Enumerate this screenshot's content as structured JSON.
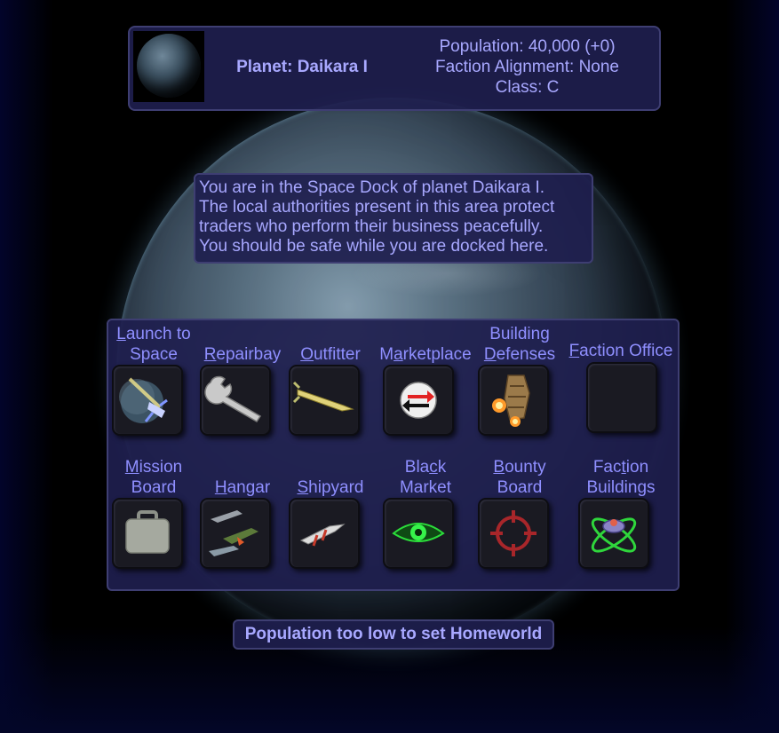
{
  "header": {
    "planet_label": "Planet: Daikara I",
    "population": "Population: 40,000 (+0)",
    "faction_alignment": "Faction Alignment: None",
    "class": "Class: C"
  },
  "message": {
    "lines": [
      "You are in the Space Dock of planet Daikara I.",
      "The local authorities present in this area protect",
      "traders who perform their business peacefully.",
      "You should be safe while you are docked here."
    ]
  },
  "menu": {
    "launch": {
      "hotkey": "L",
      "rest_line1": "aunch to",
      "line2": "Space",
      "icon": "launch-ship-icon"
    },
    "repairbay": {
      "hotkey": "R",
      "rest": "epairbay",
      "icon": "wrench-icon"
    },
    "outfitter": {
      "hotkey": "O",
      "rest": "utfitter",
      "icon": "missile-icon"
    },
    "marketplace": {
      "pre": "M",
      "hotkey": "a",
      "rest": "rketplace",
      "icon": "trade-arrows-icon"
    },
    "building_defenses": {
      "line1": "Building",
      "hotkey": "D",
      "rest_line2": "efenses",
      "icon": "defense-turret-icon"
    },
    "faction_office": {
      "hotkey": "F",
      "rest": "action Office",
      "icon": "empty-icon"
    },
    "mission_board": {
      "hotkey": "M",
      "rest_line1": "ission",
      "line2": "Board",
      "icon": "briefcase-icon"
    },
    "hangar": {
      "hotkey": "H",
      "rest": "angar",
      "icon": "ships-icon"
    },
    "shipyard": {
      "hotkey": "S",
      "rest": "hipyard",
      "icon": "shipyard-ship-icon"
    },
    "black_market": {
      "pre": "Bla",
      "hotkey": "c",
      "rest_line1": "k",
      "line2": "Market",
      "icon": "eye-icon"
    },
    "bounty_board": {
      "hotkey": "B",
      "rest_line1": "ounty",
      "line2": "Board",
      "icon": "crosshair-icon"
    },
    "faction_buildings": {
      "pre": "Fac",
      "hotkey": "t",
      "rest_line1": "ion",
      "line2": "Buildings",
      "icon": "atom-station-icon"
    }
  },
  "footer": {
    "homeworld_status": "Population too low to set Homeworld"
  },
  "colors": {
    "panel_bg": "#1e1e4e",
    "text": "#a8a8ff",
    "link": "#8f8fff"
  }
}
